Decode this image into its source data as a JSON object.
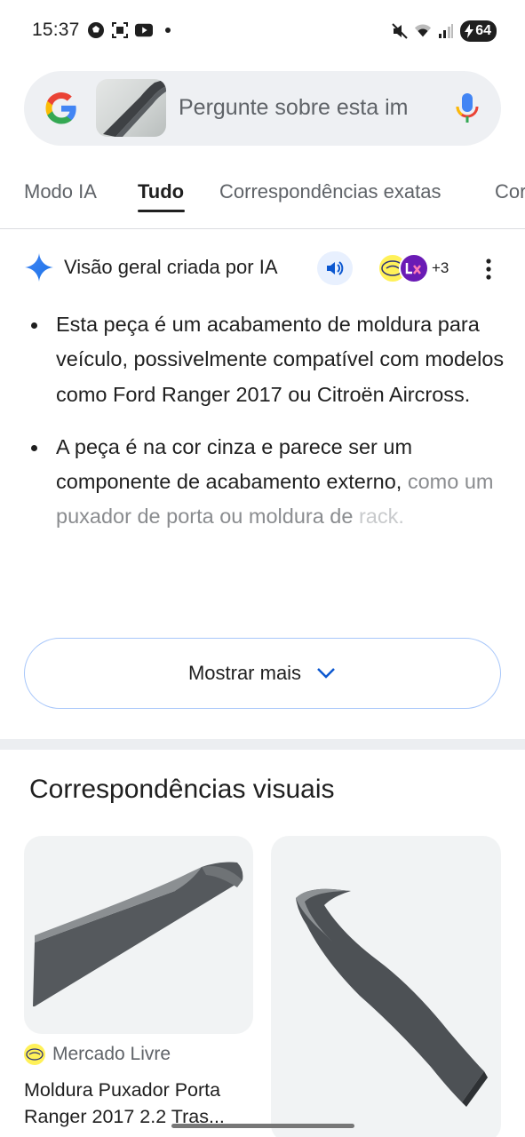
{
  "status_bar": {
    "time": "15:37",
    "battery": "64",
    "left_icons": [
      "soccer-ball-icon",
      "scan-icon",
      "youtube-icon",
      "dot-icon"
    ],
    "right_icons": [
      "mute-icon",
      "wifi-icon",
      "signal-icon",
      "battery-icon"
    ]
  },
  "search": {
    "placeholder": "Pergunte sobre esta im",
    "icons": [
      "google-logo-icon",
      "image-thumbnail",
      "mic-icon"
    ]
  },
  "tabs": [
    {
      "label": "Modo IA",
      "active": false
    },
    {
      "label": "Tudo",
      "active": true
    },
    {
      "label": "Correspondências exatas",
      "active": false
    },
    {
      "label": "Cor",
      "active": false
    }
  ],
  "ai_overview": {
    "title": "Visão geral criada por IA",
    "sources_more": "+3",
    "bullets": [
      {
        "text": "Esta peça é um acabamento de moldura para veículo, possivelmente compatível com modelos como Ford Ranger 2017 ou Citroën Aircross."
      },
      {
        "text": "A peça é na cor cinza e parece ser um componente de acabamento externo,",
        "fade": "como um puxador de porta ou moldura de",
        "faded": "rack."
      }
    ],
    "show_more_label": "Mostrar mais"
  },
  "visual_matches": {
    "title": "Correspondências visuais",
    "cards": [
      {
        "source": "Mercado Livre",
        "title_line1": "Moldura Puxador Porta",
        "title_line2": "Ranger 2017 2.2 Tras..."
      }
    ]
  },
  "colors": {
    "accent": "#1a73e8",
    "search_bg": "#eef0f3",
    "button_border": "#a8c7fa"
  }
}
